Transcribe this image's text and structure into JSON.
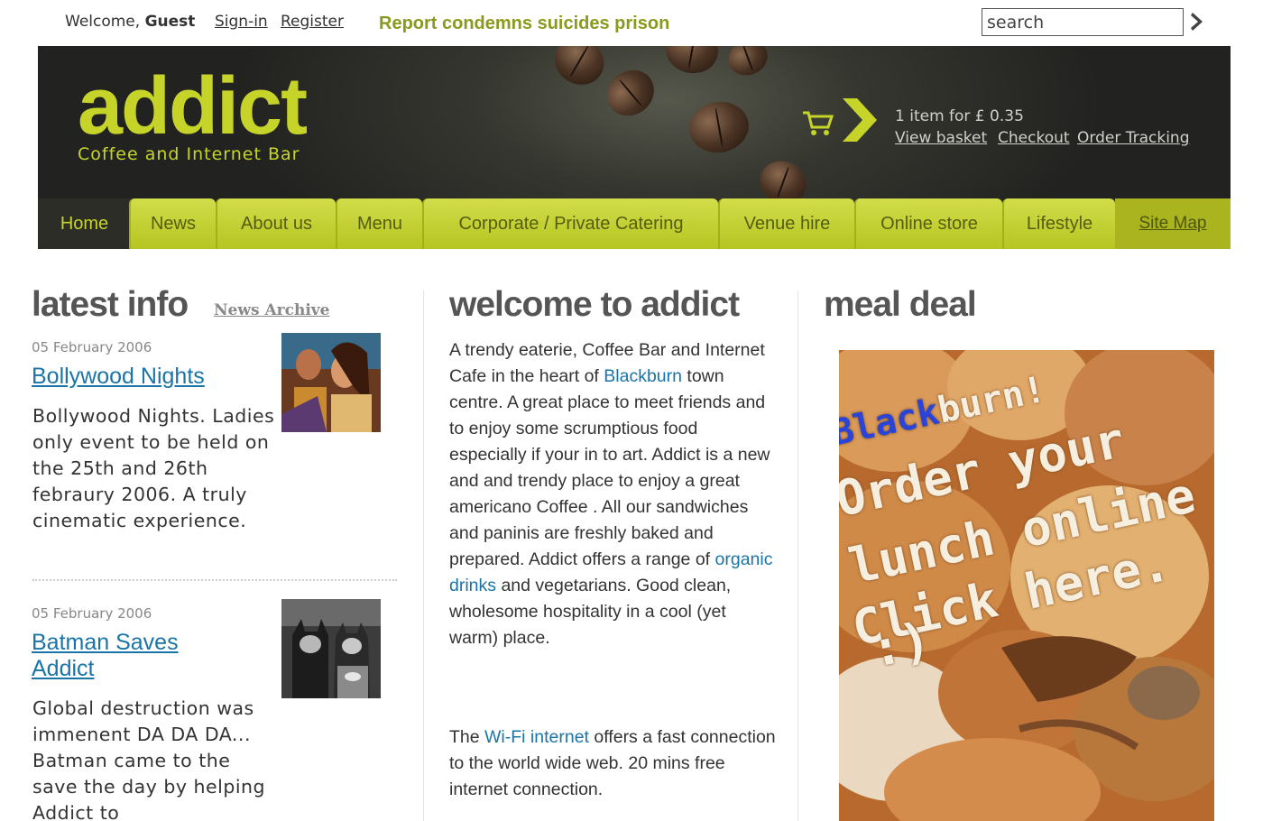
{
  "topbar": {
    "welcome_prefix": "Welcome,",
    "user": "Guest",
    "signin": "Sign-in",
    "register": "Register",
    "headline": "Report condemns suicides prison",
    "search_placeholder": "search"
  },
  "header": {
    "logo": "addict",
    "tagline": "Coffee and Internet Bar",
    "basket_count": "1 item for £ 0.35",
    "view_basket": "View basket",
    "checkout": "Checkout",
    "order_tracking": "Order Tracking"
  },
  "nav": {
    "home": "Home",
    "items": [
      "News",
      "About us",
      "Menu",
      "Corporate / Private Catering",
      "Venue hire",
      "Online store",
      "Lifestyle"
    ],
    "sitemap": "Site Map"
  },
  "latest": {
    "title": "latest info",
    "archive": "News Archive",
    "items": [
      {
        "date": "05 February 2006",
        "title": "Bollywood Nights",
        "body": "Bollywood Nights. Ladies only event to be held on the 25th and 26th febraury 2006. A truly cinematic experience."
      },
      {
        "date": "05 February 2006",
        "title": "Batman Saves Addict",
        "body": "Global destruction was immenent DA DA DA... Batman came to the save the day by helping Addict to"
      }
    ]
  },
  "welcome": {
    "title": "welcome to addict",
    "p1_a": "A trendy eaterie, Coffee Bar and Internet Cafe in the heart of",
    "p1_link1": "Blackburn",
    "p1_b": "town centre. A great place to meet friends and to enjoy some scrumptious food especially if your in to art. Addict is a new and and trendy place to enjoy a great americano Coffee . All our sandwiches and paninis are freshly baked and prepared. Addict offers a range of",
    "p1_link2": "organic drinks",
    "p1_c": "and vegetarians. Good clean, wholesome hospitality in a cool (yet warm) place.",
    "p2_a": "The",
    "p2_link": "Wi-Fi internet",
    "p2_b": "offers a fast connection to the world wide web. 20 mins free internet connection."
  },
  "mealdeal": {
    "title": "meal deal",
    "line1_blue": "Black",
    "line1_rest": "burn!",
    "line2": "Order your",
    "line3": "lunch online",
    "line4": "Click here.",
    "line5": ":)"
  },
  "colors": {
    "accent": "#c6d42a",
    "nav_tab": "#c4d135",
    "link": "#1a74a8",
    "headline": "#8a9a1c",
    "header_bg": "#2a2b26"
  }
}
